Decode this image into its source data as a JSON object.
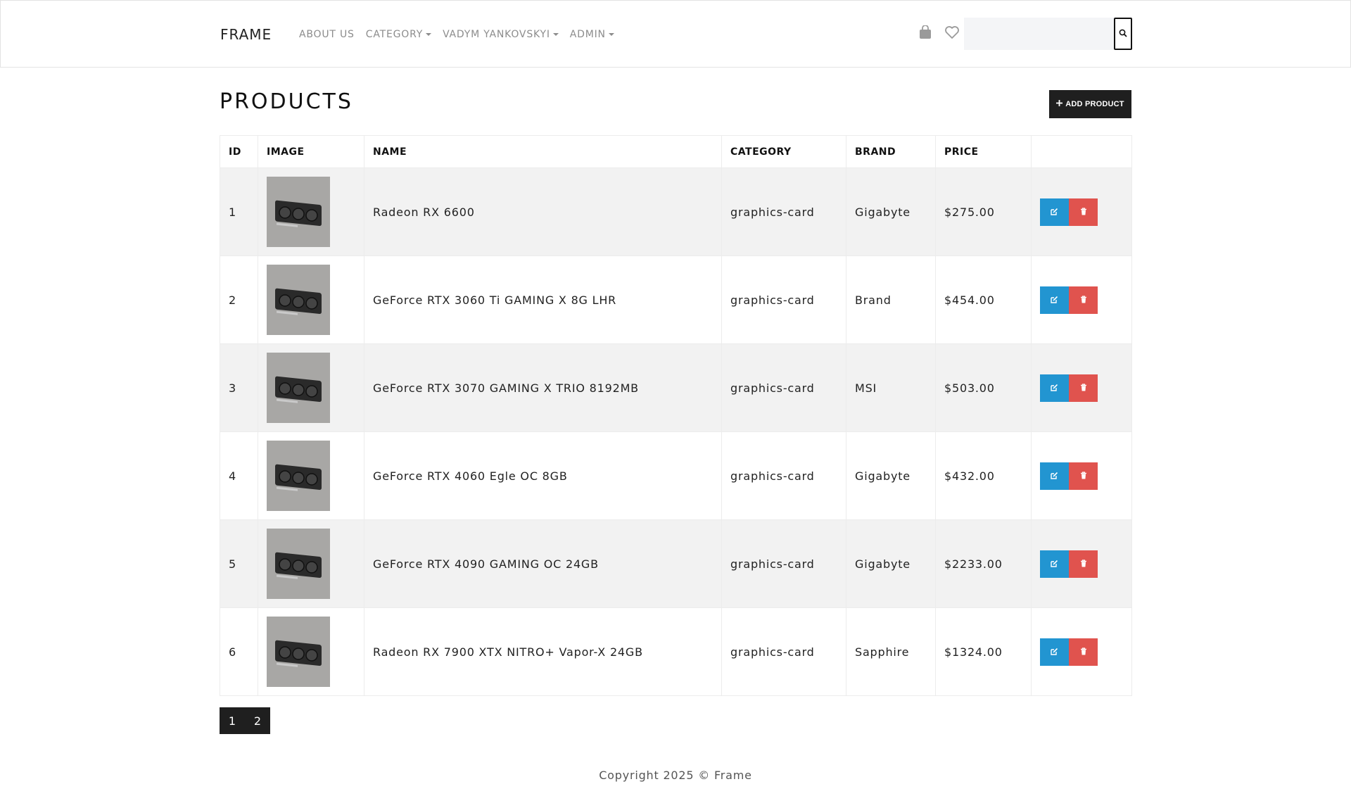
{
  "navbar": {
    "brand": "FRAME",
    "links": [
      {
        "label": "ABOUT US",
        "dropdown": false
      },
      {
        "label": "CATEGORY",
        "dropdown": true
      },
      {
        "label": "VADYM YANKOVSKYI",
        "dropdown": true
      },
      {
        "label": "ADMIN",
        "dropdown": true
      }
    ],
    "icons": [
      "shopping-bag-icon",
      "heart-icon"
    ],
    "search": {
      "value": "",
      "placeholder": "",
      "button_icon": "search-icon"
    }
  },
  "page": {
    "title": "PRODUCTS",
    "add_button_label": "ADD PRODUCT"
  },
  "table": {
    "headers": [
      "ID",
      "IMAGE",
      "NAME",
      "CATEGORY",
      "BRAND",
      "PRICE",
      ""
    ],
    "rows": [
      {
        "id": "1",
        "name": "Radeon RX 6600",
        "category": "graphics-card",
        "brand": "Gigabyte",
        "price": "$275.00"
      },
      {
        "id": "2",
        "name": "GeForce RTX 3060 Ti GAMING X 8G LHR",
        "category": "graphics-card",
        "brand": "Brand",
        "price": "$454.00"
      },
      {
        "id": "3",
        "name": "GeForce RTX 3070 GAMING X TRIO 8192MB",
        "category": "graphics-card",
        "brand": "MSI",
        "price": "$503.00"
      },
      {
        "id": "4",
        "name": "GeForce RTX 4060 Egle OC 8GB",
        "category": "graphics-card",
        "brand": "Gigabyte",
        "price": "$432.00"
      },
      {
        "id": "5",
        "name": "GeForce RTX 4090 GAMING OC 24GB",
        "category": "graphics-card",
        "brand": "Gigabyte",
        "price": "$2233.00"
      },
      {
        "id": "6",
        "name": "Radeon RX 7900 XTX NITRO+ Vapor-X 24GB",
        "category": "graphics-card",
        "brand": "Sapphire",
        "price": "$1324.00"
      }
    ]
  },
  "pagination": {
    "pages": [
      "1",
      "2"
    ]
  },
  "footer": {
    "text": "Copyright 2025 © Frame"
  },
  "colors": {
    "edit": "#2295d1",
    "delete": "#e0534e",
    "dark": "#1f1f1f"
  }
}
